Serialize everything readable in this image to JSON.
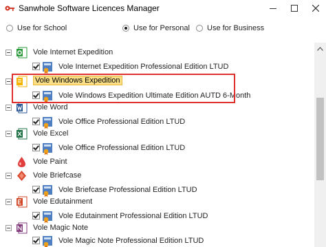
{
  "window": {
    "title": "Sanwhole Software Licences Manager",
    "icons": {
      "app": "key-icon",
      "minimize": "minimize-icon",
      "maximize": "maximize-icon",
      "close": "close-icon"
    }
  },
  "usage": {
    "options": [
      {
        "label": "Use for School",
        "selected": false
      },
      {
        "label": "Use for Personal",
        "selected": true
      },
      {
        "label": "Use for Business",
        "selected": false
      }
    ]
  },
  "tree": {
    "items": [
      {
        "category": "Vole Internet Expedition",
        "icon": "internet-expedition-icon",
        "icon_color": "#2e9b3e",
        "selected": false,
        "license": "Vole Internet Expedition Professional Edition LTUD",
        "checked": true
      },
      {
        "category": "Vole Windows Expedition",
        "icon": "windows-expedition-icon",
        "icon_color": "#f4b400",
        "selected": true,
        "license": "Vole Windows Expedition Ultimate Edition AUTD 6-Month",
        "checked": true
      },
      {
        "category": "Vole Word",
        "icon": "word-icon",
        "icon_color": "#2b5797",
        "selected": false,
        "license": "Vole Office Professional Edition LTUD",
        "checked": true
      },
      {
        "category": "Vole Excel",
        "icon": "excel-icon",
        "icon_color": "#1e7145",
        "selected": false,
        "license": "Vole Office Professional Edition LTUD",
        "checked": true
      },
      {
        "category": "Vole Paint",
        "icon": "paint-icon",
        "icon_color": "#e03d3d",
        "selected": false,
        "license": null,
        "checked": false
      },
      {
        "category": "Vole Briefcase",
        "icon": "briefcase-icon",
        "icon_color": "#d9492f",
        "selected": false,
        "license": "Vole Briefcase Professional Edition LTUD",
        "checked": true
      },
      {
        "category": "Vole Edutainment",
        "icon": "edutainment-icon",
        "icon_color": "#d24726",
        "selected": false,
        "license": "Vole Edutainment Professional Edition LTUD",
        "checked": true
      },
      {
        "category": "Vole Magic Note",
        "icon": "magic-note-icon",
        "icon_color": "#80397b",
        "selected": false,
        "license": "Vole Magic Note Professional Edition LTUD",
        "checked": true
      }
    ]
  },
  "colors": {
    "highlight_border": "#e0302d",
    "selection_fill": "#f9de86",
    "selection_border": "#e7b634"
  }
}
